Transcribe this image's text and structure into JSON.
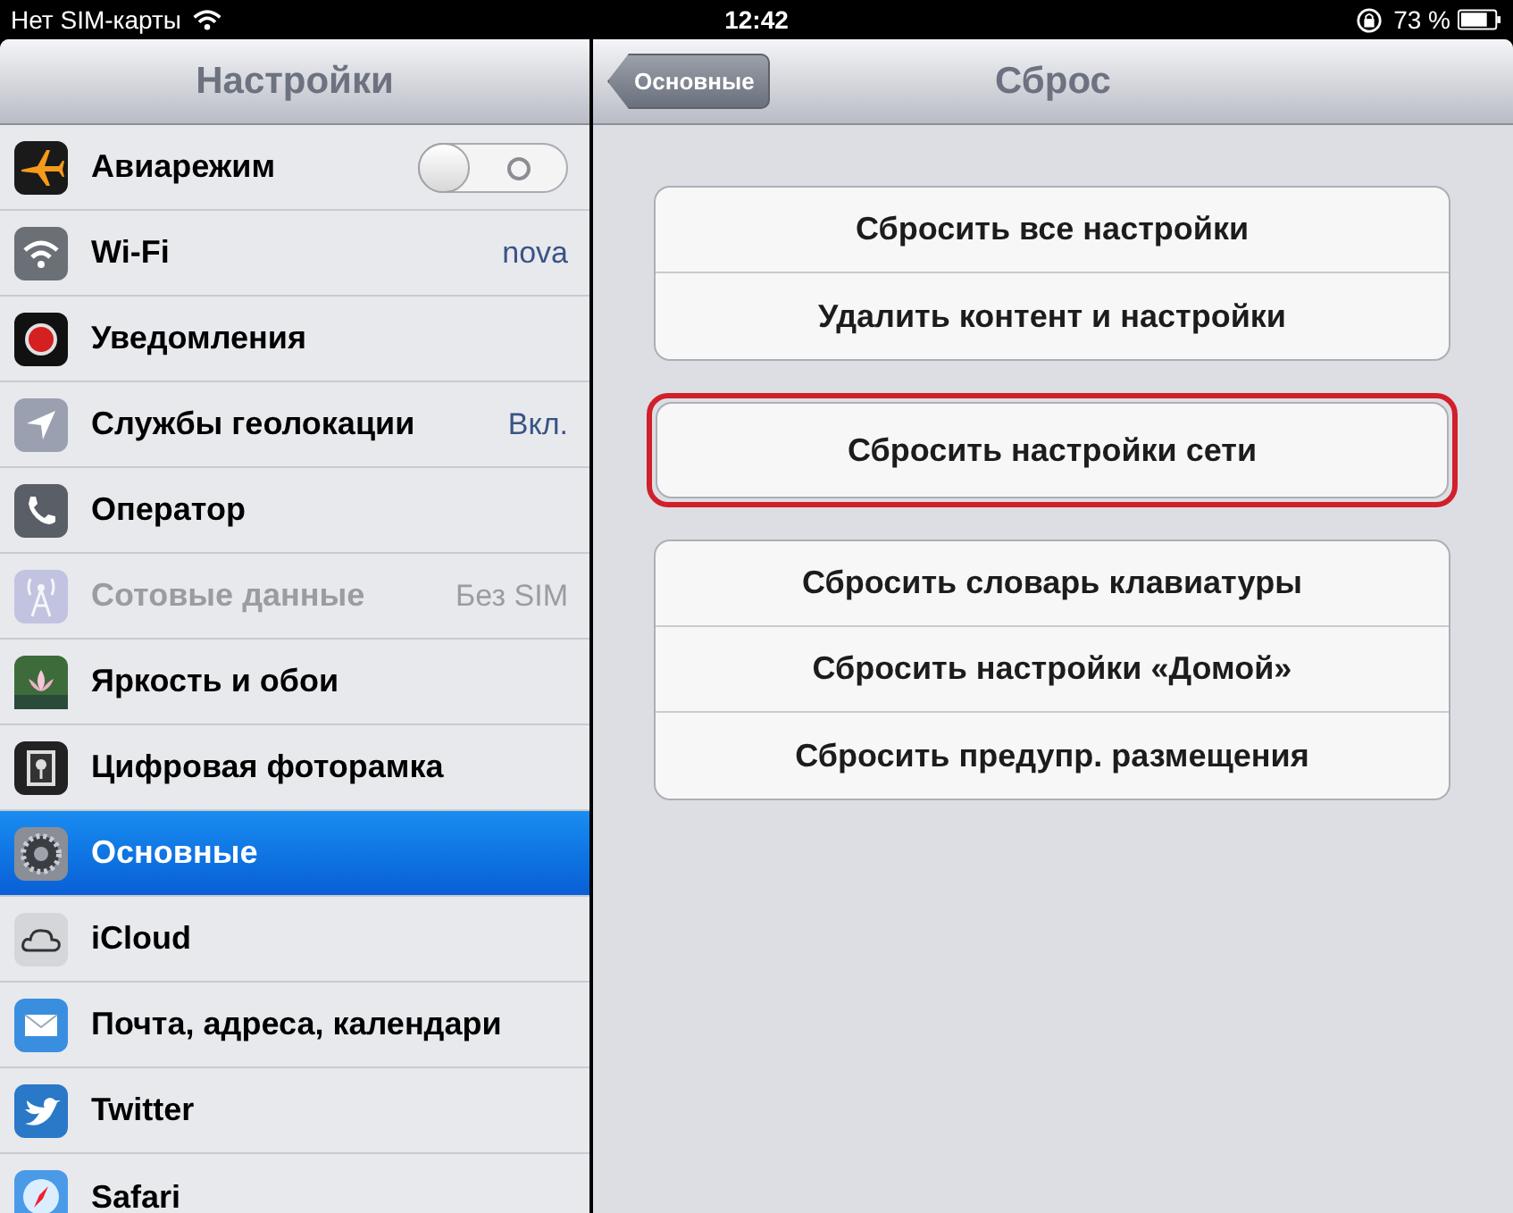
{
  "status_bar": {
    "carrier": "Нет SIM-карты",
    "time": "12:42",
    "battery": "73 %"
  },
  "sidebar": {
    "title": "Настройки",
    "items": [
      {
        "label": "Авиарежим",
        "kind": "toggle",
        "on": false,
        "selected": false,
        "disabled": false
      },
      {
        "label": "Wi-Fi",
        "kind": "value",
        "value": "nova",
        "selected": false,
        "disabled": false
      },
      {
        "label": "Уведомления",
        "kind": "plain",
        "selected": false,
        "disabled": false
      },
      {
        "label": "Службы геолокации",
        "kind": "value",
        "value": "Вкл.",
        "selected": false,
        "disabled": false
      },
      {
        "label": "Оператор",
        "kind": "plain",
        "selected": false,
        "disabled": false
      },
      {
        "label": "Сотовые данные",
        "kind": "value",
        "value": "Без SIM",
        "selected": false,
        "disabled": true
      },
      {
        "label": "Яркость и обои",
        "kind": "plain",
        "selected": false,
        "disabled": false
      },
      {
        "label": "Цифровая фоторамка",
        "kind": "plain",
        "selected": false,
        "disabled": false
      },
      {
        "label": "Основные",
        "kind": "plain",
        "selected": true,
        "disabled": false
      },
      {
        "label": "iCloud",
        "kind": "plain",
        "selected": false,
        "disabled": false
      },
      {
        "label": "Почта, адреса, календари",
        "kind": "plain",
        "selected": false,
        "disabled": false
      },
      {
        "label": "Twitter",
        "kind": "plain",
        "selected": false,
        "disabled": false
      },
      {
        "label": "Safari",
        "kind": "plain",
        "selected": false,
        "disabled": false
      }
    ]
  },
  "detail": {
    "back_button": "Основные",
    "title": "Сброс",
    "groups": [
      {
        "highlighted": false,
        "items": [
          "Сбросить все настройки",
          "Удалить контент и настройки"
        ]
      },
      {
        "highlighted": true,
        "items": [
          "Сбросить настройки сети"
        ]
      },
      {
        "highlighted": false,
        "items": [
          "Сбросить словарь клавиатуры",
          "Сбросить настройки «Домой»",
          "Сбросить предупр. размещения"
        ]
      }
    ]
  }
}
